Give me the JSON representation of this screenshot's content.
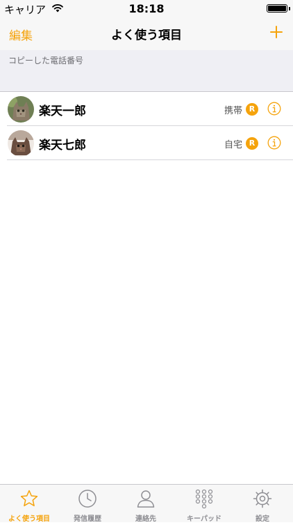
{
  "status_bar": {
    "carrier": "キャリア",
    "time": "18:18",
    "battery_level": 1.0
  },
  "nav": {
    "edit_label": "編集",
    "title": "よく使う項目",
    "add_icon": "plus-icon"
  },
  "clipboard": {
    "label": "コピーした電話番号"
  },
  "contacts": [
    {
      "name": "楽天一郎",
      "phone_type": "携帯",
      "badge": "R",
      "avatar_icon": "cat-photo-avatar",
      "info_icon": "info-icon"
    },
    {
      "name": "楽天七郎",
      "phone_type": "自宅",
      "badge": "R",
      "avatar_icon": "cat-photo-avatar",
      "info_icon": "info-icon"
    }
  ],
  "tabs": [
    {
      "label": "よく使う項目",
      "icon": "star-icon",
      "active": true
    },
    {
      "label": "発信履歴",
      "icon": "clock-icon",
      "active": false
    },
    {
      "label": "連絡先",
      "icon": "person-icon",
      "active": false
    },
    {
      "label": "キーパッド",
      "icon": "keypad-icon",
      "active": false
    },
    {
      "label": "設定",
      "icon": "gear-icon",
      "active": false
    }
  ],
  "colors": {
    "accent": "#f5a30c",
    "inactive_tab": "#8e8e93",
    "section_bg": "#efeff4"
  }
}
